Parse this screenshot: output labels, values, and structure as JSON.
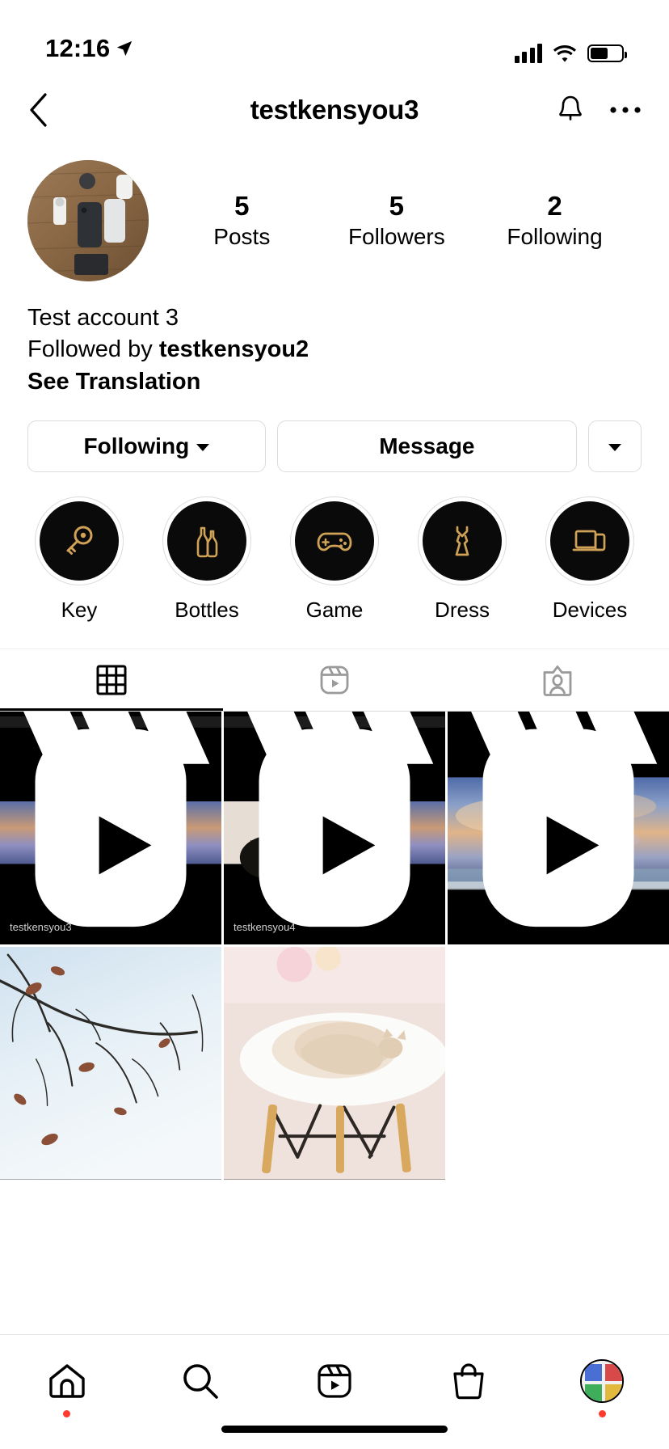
{
  "status_bar": {
    "time": "12:16",
    "location_icon": "location-arrow-icon",
    "signal_icon": "cellular-signal-icon",
    "wifi_icon": "wifi-icon",
    "battery_icon": "battery-icon",
    "battery_level_pct": 58
  },
  "header": {
    "back_icon": "chevron-left-icon",
    "title": "testkensyou3",
    "bell_icon": "bell-icon",
    "more_icon": "ellipsis-horizontal-icon"
  },
  "profile": {
    "avatar_name": "profile-avatar",
    "stats": [
      {
        "value": "5",
        "label": "Posts"
      },
      {
        "value": "5",
        "label": "Followers"
      },
      {
        "value": "2",
        "label": "Following"
      }
    ],
    "bio": {
      "display_name": "Test account 3",
      "followed_by_prefix": "Followed by ",
      "followed_by_user": "testkensyou2",
      "see_translation": "See Translation"
    },
    "buttons": {
      "following": "Following",
      "message": "Message",
      "more_chevron": "chevron-down-icon"
    }
  },
  "highlights": [
    {
      "label": "Key",
      "icon": "key-icon"
    },
    {
      "label": "Bottles",
      "icon": "bottles-icon"
    },
    {
      "label": "Game",
      "icon": "gamepad-icon"
    },
    {
      "label": "Dress",
      "icon": "dress-icon"
    },
    {
      "label": "Devices",
      "icon": "devices-icon"
    }
  ],
  "tabs": [
    {
      "name": "grid",
      "icon": "grid-icon",
      "active": true
    },
    {
      "name": "reels",
      "icon": "reels-icon",
      "active": false
    },
    {
      "name": "tagged",
      "icon": "tagged-icon",
      "active": false
    }
  ],
  "posts": [
    {
      "type": "reel",
      "badge": "reel-icon",
      "watermark": "testkensyou3",
      "style": "sunset-cat"
    },
    {
      "type": "reel",
      "badge": "reel-icon",
      "watermark": "testkensyou4",
      "style": "cat-sunset"
    },
    {
      "type": "reel",
      "badge": "reel-icon",
      "watermark": "",
      "style": "sunset-sea"
    },
    {
      "type": "photo",
      "badge": "",
      "watermark": "",
      "style": "branches-sky"
    },
    {
      "type": "photo",
      "badge": "",
      "watermark": "",
      "style": "cat-table"
    }
  ],
  "bottom_nav": [
    {
      "name": "home",
      "icon": "home-icon",
      "dot": true
    },
    {
      "name": "search",
      "icon": "search-icon",
      "dot": false
    },
    {
      "name": "reels",
      "icon": "reels-icon",
      "dot": false
    },
    {
      "name": "shop",
      "icon": "shop-bag-icon",
      "dot": false
    },
    {
      "name": "profile",
      "icon": "profile-avatar-icon",
      "dot": true
    }
  ],
  "colors": {
    "highlight_gold": "#cfa257",
    "highlight_bg": "#0a0a0a",
    "border": "#dbdbdb",
    "accent_dot": "#ff3b30",
    "inactive_tab": "#9a9a9a"
  }
}
